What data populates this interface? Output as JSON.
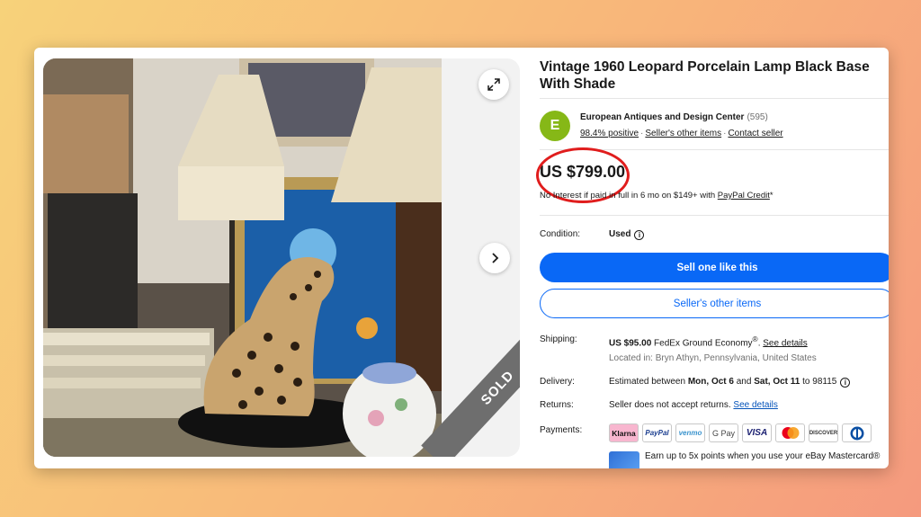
{
  "gallery": {
    "badge": "SOLD",
    "expand_icon": "expand-icon",
    "next_icon": "chevron-right-icon"
  },
  "item": {
    "title": "Vintage 1960 Leopard Porcelain Lamp Black Base With Shade"
  },
  "seller": {
    "initial": "E",
    "name": "European Antiques and Design Center",
    "feedback_count": "(595)",
    "positive": "98.4% positive",
    "other_items_link": "Seller's other items",
    "contact_link": "Contact seller",
    "avatar_color": "#86b817"
  },
  "price": {
    "amount": "US $799.00",
    "credit_text": "No Interest if paid in full in 6 mo on $149+ with",
    "credit_link": "PayPal Credit",
    "credit_suffix": "*",
    "highlight_color": "#e01d1d"
  },
  "details": {
    "condition_label": "Condition:",
    "condition_value": "Used",
    "sell_button": "Sell one like this",
    "other_items_button": "Seller's other items",
    "shipping_label": "Shipping:",
    "shipping_price": "US $95.00",
    "shipping_service": "FedEx Ground Economy",
    "shipping_reg": "®",
    "shipping_link": "See details",
    "location": "Located in: Bryn Athyn, Pennsylvania, United States",
    "delivery_label": "Delivery:",
    "delivery_prefix": "Estimated between",
    "delivery_start": "Mon, Oct 6",
    "delivery_and": "and",
    "delivery_end": "Sat, Oct 11",
    "delivery_to": "to 98115",
    "returns_label": "Returns:",
    "returns_value": "Seller does not accept returns.",
    "returns_link": "See details",
    "payments_label": "Payments:",
    "payment_methods": [
      "Klarna",
      "PayPal",
      "venmo",
      "G Pay",
      "VISA",
      "",
      "DISCOVER",
      ""
    ],
    "earn_text": "Earn up to 5x points when you use your eBay Mastercard®",
    "primary_color": "#0968f6"
  }
}
